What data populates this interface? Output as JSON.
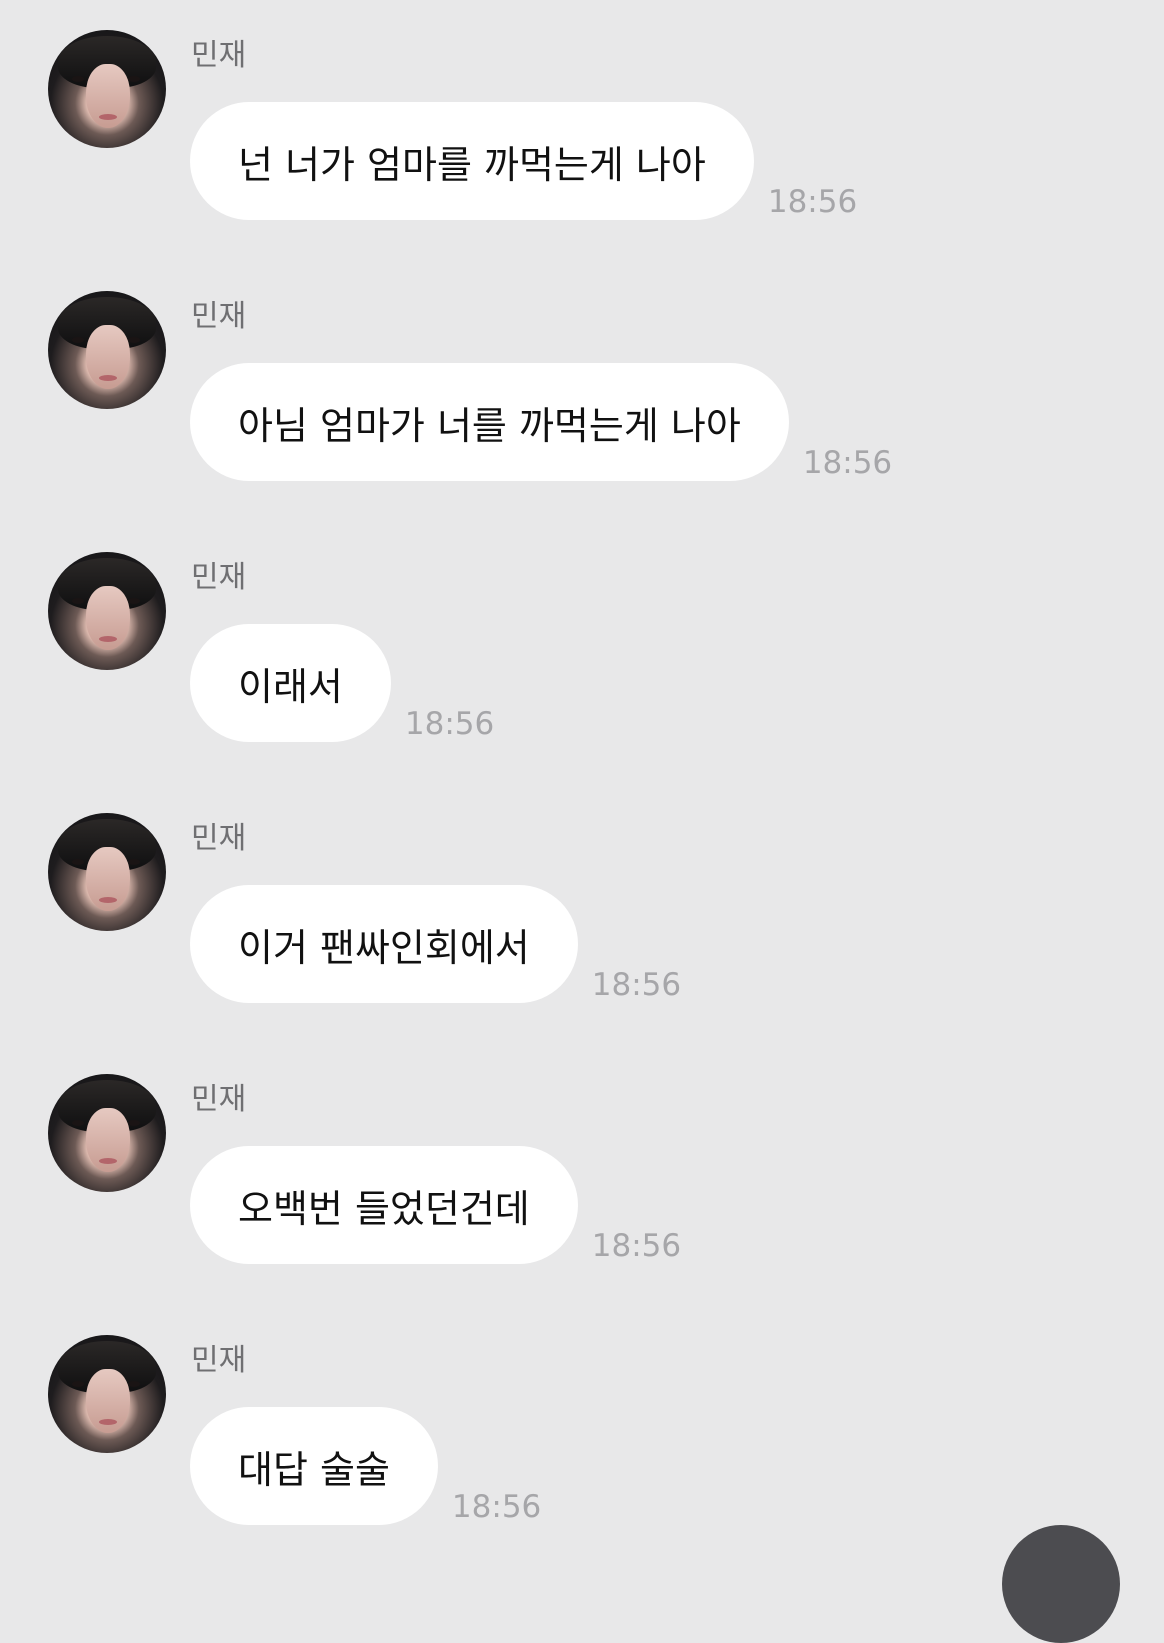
{
  "messages": [
    {
      "sender": "민재",
      "text": "넌 너가 엄마를 까먹는게 나아",
      "time": "18:56"
    },
    {
      "sender": "민재",
      "text": "아님 엄마가 너를 까먹는게 나아",
      "time": "18:56"
    },
    {
      "sender": "민재",
      "text": "이래서",
      "time": "18:56"
    },
    {
      "sender": "민재",
      "text": "이거 팬싸인회에서",
      "time": "18:56"
    },
    {
      "sender": "민재",
      "text": "오백번 들었던건데",
      "time": "18:56"
    },
    {
      "sender": "민재",
      "text": "대답 술술",
      "time": "18:56"
    }
  ],
  "colors": {
    "background": "#e8e8e9",
    "bubble": "#ffffff",
    "sender_name": "#6f6f72",
    "timestamp": "#a6a6a9",
    "fab": "#4c4c50"
  },
  "icons": {
    "avatar": "profile-photo",
    "fab": "floating-action-button"
  }
}
